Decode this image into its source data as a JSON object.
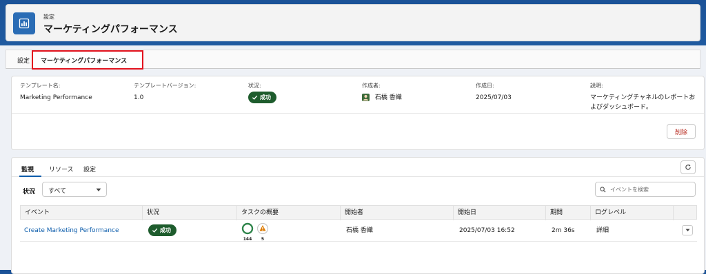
{
  "header": {
    "breadcrumb": "設定",
    "title": "マーケティングパフォーマンス",
    "icon": "chart-icon"
  },
  "tabs": {
    "items": [
      "設定",
      "マーケティングパフォーマンス"
    ],
    "active_index": 1,
    "highlight_color": "#e3121d"
  },
  "info": {
    "template_name_label": "テンプレート名:",
    "template_name": "Marketing Performance",
    "template_version_label": "テンプレートバージョン:",
    "template_version": "1.0",
    "status_label": "状況:",
    "status": "成功",
    "created_by_label": "作成者:",
    "created_by": "石橋 香織",
    "created_date_label": "作成日:",
    "created_date": "2025/07/03",
    "description_label": "説明:",
    "description_line1": "マーケティングチャネルのレポートお",
    "description_line2": "よびダッシュボード。",
    "delete_label": "削除"
  },
  "monitor": {
    "tabs": [
      "監視",
      "リソース",
      "設定"
    ],
    "active_tab": "監視",
    "filter_label": "状況",
    "filter_value": "すべて",
    "search_placeholder": "イベントを検索",
    "columns": [
      "イベント",
      "状況",
      "タスクの概要",
      "開始者",
      "開始日",
      "期間",
      "ログレベル"
    ],
    "rows": [
      {
        "event": "Create Marketing Performance",
        "status": "成功",
        "task_success_count": "144",
        "task_warning_count": "5",
        "started_by": "石橋 香織",
        "start_date": "2025/07/03 16:52",
        "duration": "2m 36s",
        "log_level": "詳細"
      }
    ]
  },
  "colors": {
    "success_badge": "#1e5c2d",
    "link": "#0b5cab",
    "delete_text": "#b7281d",
    "warning": "#dd7a01"
  }
}
